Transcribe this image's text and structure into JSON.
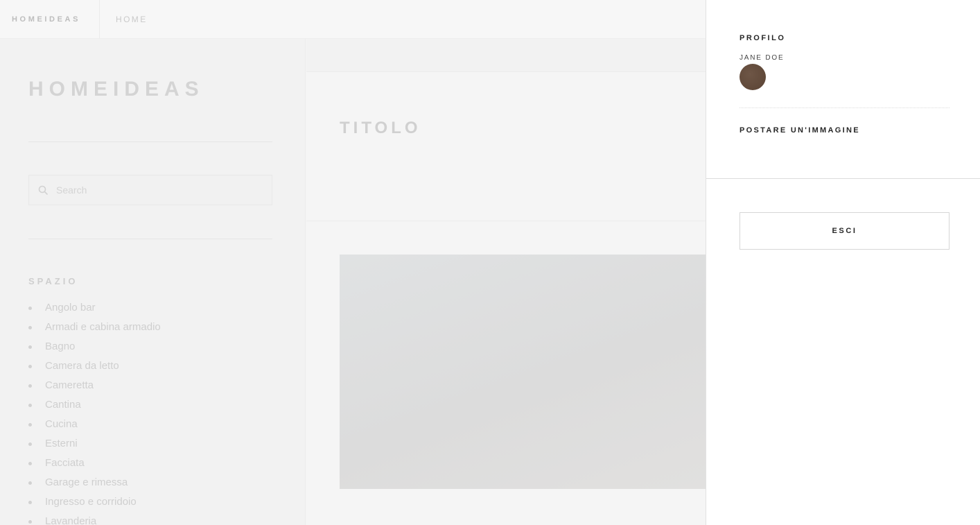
{
  "topbar": {
    "brand": "HOMEIDEAS",
    "home_link": "HOME"
  },
  "sidebar": {
    "logo": "HOMEIDEAS",
    "search": {
      "placeholder": "Search",
      "value": "",
      "icon": "search-icon"
    },
    "section_heading": "SPAZIO",
    "categories": [
      "Angolo bar",
      "Armadi e cabina armadio",
      "Bagno",
      "Camera da letto",
      "Cameretta",
      "Cantina",
      "Cucina",
      "Esterni",
      "Facciata",
      "Garage e rimessa",
      "Ingresso e corridoio",
      "Lavanderia"
    ]
  },
  "main": {
    "title": "TITOLO"
  },
  "drawer": {
    "profile_heading": "PROFILO",
    "user_name": "JANE DOE",
    "post_image_label": "POSTARE UN'IMMAGINE",
    "logout_label": "ESCI"
  },
  "colors": {
    "drawer_background": "#ffffff",
    "avatar": "#5f4839",
    "dimmed_text": "#cfcfcf"
  }
}
